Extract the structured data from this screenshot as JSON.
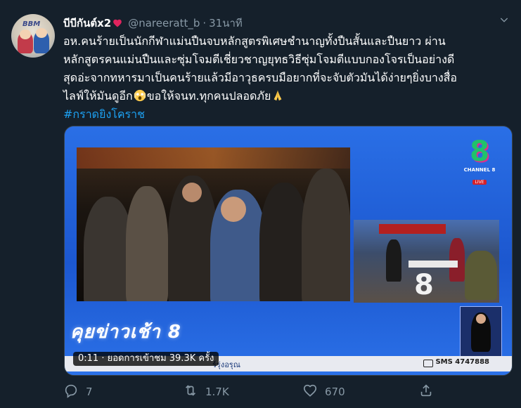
{
  "tweet": {
    "display_name": "บีบีกันต์x2",
    "handle": "@nareeratt_b",
    "separator": "·",
    "time": "31นาที",
    "avatar_text": "BBM",
    "text_lines": [
      "อห.คนร้ายเป็นนักกีฬาแม่นปืนจบหลักสูตรพิเศษชำนาญทั้งปืนสั้นและปืนยาว ผ่าน",
      "หลักสูตรคนแม่นปืนและซุ่มโจมตีเชี่ยวชาญยุทธวิธีซุ่มโจมตีแบบกองโจรเป็นอย่างดี",
      "สุดอ่ะจากทหารมาเป็นคนร้ายแล้วมีอาวุธครบมือยากที่จะจับตัวมันได้ง่ายๆยิ่งบางสื่อ"
    ],
    "last_line_part1": "ไลฟ์ให้มันดูอีก",
    "last_line_part2": "ขอให้จนท.ทุกคนปลอดภัย",
    "hashtag": "#กราดยิงโคราช"
  },
  "media": {
    "time_badge": "0:11 · ยอดการเข้าชม 39.3K ครั้ง",
    "channel_logo": "8",
    "channel_name": "CHANNEL 8",
    "live_label": "LIVE",
    "show_logo": "คุยข่าวเช้า 8",
    "ticker_text": "ร์รุ่งอรุณ",
    "sms_text": "SMS 4747888",
    "side_logo": "8"
  },
  "actions": {
    "reply_count": "7",
    "retweet_count": "1.7K",
    "like_count": "670"
  },
  "icons": {
    "heart_emoji": "red-heart-icon",
    "scream_emoji": "scream-face-icon",
    "pray_emoji": "folded-hands-icon",
    "reply": "reply-icon",
    "retweet": "retweet-icon",
    "like": "like-icon",
    "share": "share-icon",
    "more": "chevron-down-icon"
  },
  "colors": {
    "background": "#15202b",
    "text": "#ffffff",
    "secondary_text": "#8899a6",
    "link": "#1da1f2",
    "media_border": "#38444d",
    "heart": "#e0245e"
  }
}
